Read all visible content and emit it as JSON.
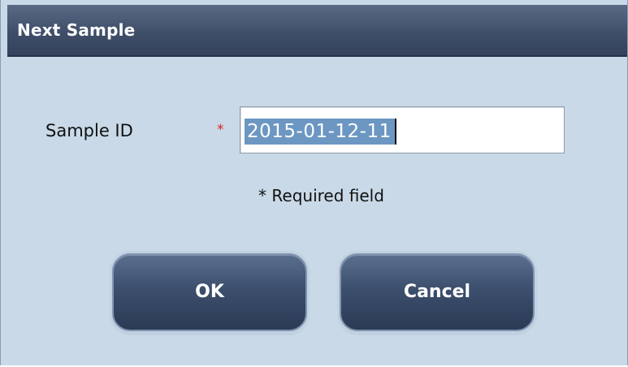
{
  "dialog": {
    "title": "Next Sample",
    "sample_id": {
      "label": "Sample ID",
      "required_marker": "*",
      "value": "2015-01-12-11",
      "selected": true
    },
    "required_note": "* Required field",
    "buttons": {
      "ok_label": "OK",
      "cancel_label": "Cancel"
    }
  },
  "colors": {
    "titlebar": "#3f4e69",
    "dialog_background": "#c9d9e8",
    "selection_highlight": "#6c97c2",
    "required_marker": "#e02020",
    "button": "#3c4f6d"
  }
}
